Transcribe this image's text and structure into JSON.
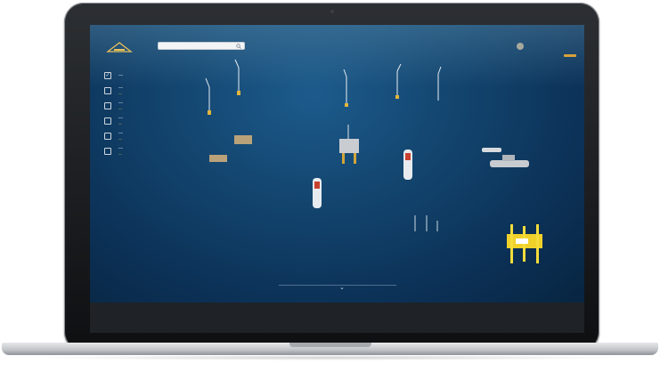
{
  "app": {
    "logo_icon": "company-logo-icon"
  },
  "search": {
    "placeholder": "",
    "icon": "search-icon"
  },
  "menu": {
    "items": [
      {
        "label": "—",
        "sublabel": "",
        "checked": true
      },
      {
        "label": "—",
        "sublabel": "—",
        "checked": false
      },
      {
        "label": "—",
        "sublabel": "—",
        "checked": false
      },
      {
        "label": "—",
        "sublabel": "—",
        "checked": false
      },
      {
        "label": "—",
        "sublabel": "—",
        "checked": false
      },
      {
        "label": "—",
        "sublabel": "—",
        "checked": false
      }
    ]
  },
  "footer": {
    "link_text": ""
  },
  "scene": {
    "center_label": "",
    "chevron": "⌄"
  },
  "colors": {
    "ocean": "#134670",
    "accent_yellow": "#f0c23a",
    "bottom_bar": "#1f2226",
    "bezel": "#0e0f11"
  }
}
